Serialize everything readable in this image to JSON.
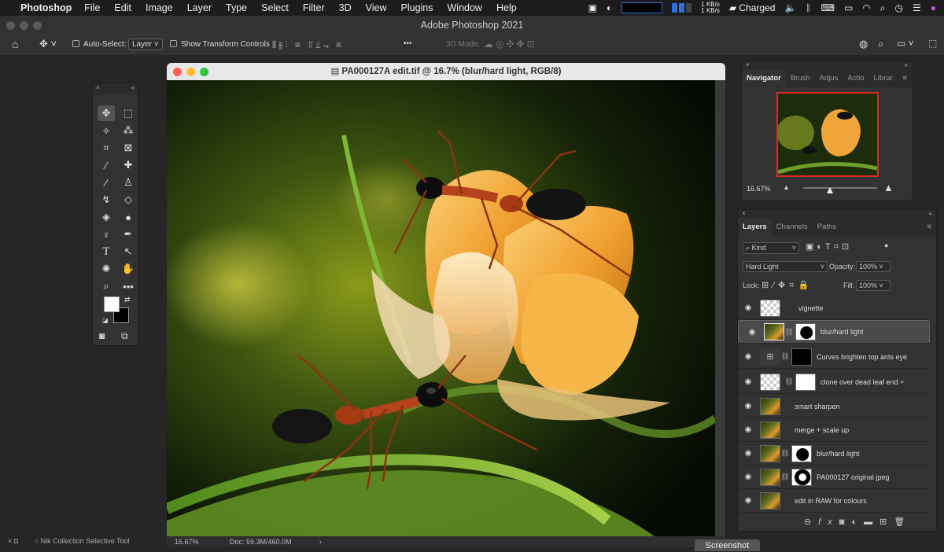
{
  "menubar": {
    "apple": "",
    "app_name": "Photoshop",
    "menus": [
      "File",
      "Edit",
      "Image",
      "Layer",
      "Type",
      "Select",
      "Filter",
      "3D",
      "View",
      "Plugins",
      "Window",
      "Help"
    ],
    "kbs_up": "1 KB/s",
    "kbs_down": "1 KB/s",
    "battery_status": "Charged"
  },
  "titlebar": {
    "title": "Adobe Photoshop 2021"
  },
  "options": {
    "auto_select_label": "Auto-Select:",
    "auto_select_value": "Layer",
    "show_transform_label": "Show Transform Controls",
    "mode_3d_label": "3D Mode:",
    "more": "•••"
  },
  "document": {
    "title": "PA000127A edit.tif @ 16.7% (blur/hard light, RGB/8)",
    "zoom": "16.67%",
    "doc_size": "Doc: 59.3M/460.0M"
  },
  "bottom_left": {
    "plugin": "Nik Collection Selective Tool"
  },
  "screenshot_label": "Screenshot",
  "navigator": {
    "tabs": [
      "Navigator",
      "Brush",
      "Adjus",
      "Actio",
      "Librar"
    ],
    "zoom": "16.67%"
  },
  "layers_panel": {
    "tabs": [
      "Layers",
      "Channels",
      "Paths"
    ],
    "kind_label": "Kind",
    "blend_mode": "Hard Light",
    "opacity_label": "Opacity:",
    "opacity": "100%",
    "lock_label": "Lock:",
    "fill_label": "Fill:",
    "fill": "100%",
    "layers": [
      {
        "name": "vignette"
      },
      {
        "name": "blur/hard light"
      },
      {
        "name": "Curves brighten top ants eye"
      },
      {
        "name": "clone over dead leaf end +"
      },
      {
        "name": "smart sharpen"
      },
      {
        "name": "merge + scale up"
      },
      {
        "name": "blur/hard light"
      },
      {
        "name": "PA000127 original jpeg"
      },
      {
        "name": "edit in RAW for colours"
      }
    ]
  },
  "colors": {
    "accent_red": "#e02626",
    "selected_layer": "#4a4a4a"
  }
}
